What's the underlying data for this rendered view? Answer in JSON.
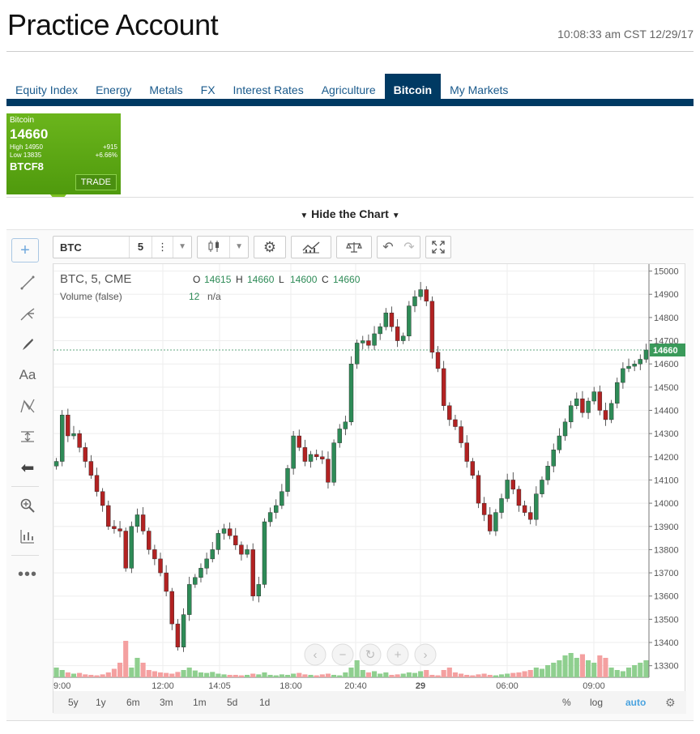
{
  "header": {
    "title": "Practice Account",
    "timestamp": "10:08:33 am CST 12/29/17"
  },
  "tabs": [
    {
      "label": "Equity Index"
    },
    {
      "label": "Energy"
    },
    {
      "label": "Metals"
    },
    {
      "label": "FX"
    },
    {
      "label": "Interest Rates"
    },
    {
      "label": "Agriculture"
    },
    {
      "label": "Bitcoin",
      "active": true
    },
    {
      "label": "My Markets"
    }
  ],
  "tile": {
    "name": "Bitcoin",
    "price": "14660",
    "high": "High 14950",
    "change": "+915",
    "low": "Low 13835",
    "change_pct": "+6.66%",
    "code": "BTCF8",
    "trade_label": "TRADE",
    "color": "#6bb51c"
  },
  "chart_toggle": {
    "label": "Hide the Chart"
  },
  "toolbar": {
    "symbol": "BTC",
    "interval": "5"
  },
  "legend": {
    "title": "BTC, 5, CME",
    "o_label": "O",
    "o": "14615",
    "h_label": "H",
    "h": "14660",
    "l_label": "L",
    "l": "14600",
    "c_label": "C",
    "c": "14660",
    "volume_label": "Volume (false)",
    "volume_value": "12",
    "volume_na": "n/a"
  },
  "range_buttons": [
    "5y",
    "1y",
    "6m",
    "3m",
    "1m",
    "5d",
    "1d"
  ],
  "scale_buttons": {
    "pct": "%",
    "log": "log",
    "auto": "auto"
  },
  "chart_data": {
    "type": "candlestick",
    "ylim": [
      13250,
      15030
    ],
    "y_ticks": [
      "15000",
      "14900",
      "14800",
      "14700",
      "14600",
      "14500",
      "14400",
      "14300",
      "14200",
      "14100",
      "14000",
      "13900",
      "13800",
      "13700",
      "13600",
      "13500",
      "13400",
      "13300"
    ],
    "x_ticks": [
      "9:00",
      "12:00",
      "14:05",
      "18:00",
      "20:40",
      "29",
      "06:00",
      "09:00"
    ],
    "last_price_label": "14660",
    "last_price": 14660,
    "up_color": "#2e8b57",
    "down_color": "#b22222",
    "close_path": [
      14180,
      14380,
      14290,
      14300,
      14240,
      14180,
      14120,
      14050,
      13990,
      13900,
      13890,
      13880,
      13720,
      13900,
      13950,
      13880,
      13800,
      13760,
      13700,
      13620,
      13480,
      13380,
      13520,
      13650,
      13680,
      13720,
      13760,
      13800,
      13870,
      13890,
      13860,
      13820,
      13780,
      13800,
      13600,
      13650,
      13920,
      13960,
      13990,
      14050,
      14150,
      14290,
      14240,
      14180,
      14210,
      14200,
      14190,
      14090,
      14260,
      14320,
      14350,
      14600,
      14690,
      14700,
      14680,
      14730,
      14760,
      14820,
      14760,
      14700,
      14720,
      14850,
      14890,
      14920,
      14870,
      14650,
      14580,
      14420,
      14360,
      14330,
      14260,
      14180,
      14120,
      14000,
      13950,
      13880,
      13960,
      14020,
      14100,
      14060,
      13990,
      13960,
      13930,
      14040,
      14100,
      14160,
      14230,
      14290,
      14350,
      14420,
      14450,
      14390,
      14440,
      14480,
      14400,
      14360,
      14430,
      14520,
      14580,
      14590,
      14600,
      14620,
      14660
    ],
    "volume": [
      40,
      30,
      20,
      15,
      18,
      12,
      10,
      8,
      12,
      20,
      35,
      60,
      150,
      40,
      80,
      60,
      30,
      25,
      20,
      18,
      15,
      22,
      30,
      40,
      28,
      20,
      18,
      22,
      15,
      12,
      10,
      10,
      8,
      10,
      15,
      12,
      20,
      10,
      8,
      12,
      10,
      15,
      18,
      12,
      10,
      8,
      12,
      15,
      10,
      8,
      20,
      40,
      70,
      30,
      20,
      25,
      15,
      20,
      10,
      12,
      15,
      20,
      18,
      25,
      30,
      10,
      8,
      30,
      40,
      20,
      15,
      10,
      8,
      12,
      15,
      10,
      8,
      12,
      15,
      18,
      20,
      25,
      30,
      40,
      35,
      50,
      60,
      70,
      90,
      100,
      80,
      95,
      70,
      60,
      90,
      80,
      40,
      30,
      25,
      40,
      50,
      60,
      70
    ]
  }
}
